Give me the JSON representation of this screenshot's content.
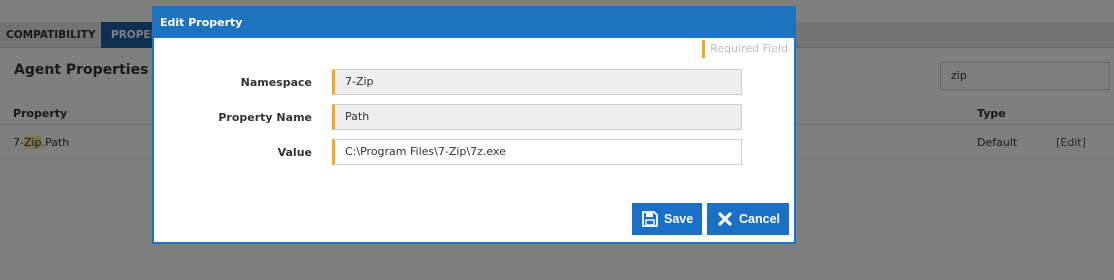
{
  "background": {
    "tabs": [
      {
        "label": "COMPATIBILITY"
      },
      {
        "label": "PROPERTIES"
      }
    ],
    "heading": "Agent Properties",
    "search_value": "zip",
    "columns": {
      "property": "Property",
      "type": "Type"
    },
    "rows": [
      {
        "property_prefix": "7-",
        "property_highlight": "Zip",
        "property_suffix": ".Path",
        "type": "Default",
        "action": "[Edit]"
      }
    ]
  },
  "modal": {
    "title": "Edit Property",
    "required_legend": "Required Field",
    "fields": [
      {
        "label": "Namespace",
        "value": "7-Zip"
      },
      {
        "label": "Property Name",
        "value": "Path"
      },
      {
        "label": "Value",
        "value": "C:\\Program Files\\7-Zip\\7z.exe"
      }
    ],
    "buttons": {
      "save": "Save",
      "cancel": "Cancel"
    },
    "icons": {
      "save": "floppy-disk-icon",
      "cancel": "x-icon"
    }
  },
  "colors": {
    "accent": "#1e73be",
    "required_marker": "#f5a623",
    "highlight": "#f3ee9a"
  }
}
